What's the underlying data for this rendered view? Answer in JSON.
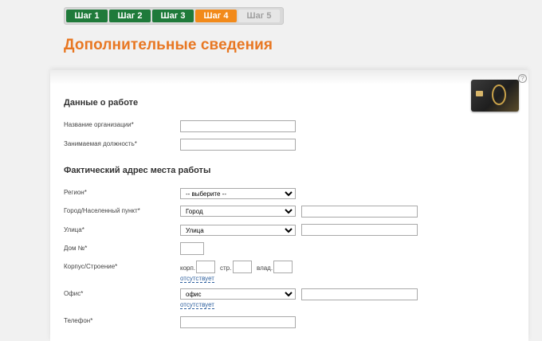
{
  "steps": [
    {
      "label": "Шаг 1",
      "state": "done"
    },
    {
      "label": "Шаг 2",
      "state": "done"
    },
    {
      "label": "Шаг 3",
      "state": "done"
    },
    {
      "label": "Шаг 4",
      "state": "active"
    },
    {
      "label": "Шаг 5",
      "state": "todo"
    }
  ],
  "page_title": "Дополнительные сведения",
  "help_icon": "?",
  "colors": {
    "step_done": "#1f7a3a",
    "step_active": "#f28a1a",
    "title": "#e87722",
    "link": "#2d5f9e"
  },
  "work": {
    "title": "Данные о работе",
    "org_label": "Название организации",
    "org_value": "",
    "position_label": "Занимаемая должность",
    "position_value": ""
  },
  "address": {
    "title": "Фактический адрес места работы",
    "region_label": "Регион",
    "region_value": "-- выберите --",
    "city_label": "Город/Населенный пункт",
    "city_type": "Город",
    "city_value": "",
    "street_label": "Улица",
    "street_type": "Улица",
    "street_value": "",
    "house_label": "Дом №",
    "house_value": "",
    "building_label": "Корпус/Строение",
    "korp_label": "корп.",
    "str_label": "стр.",
    "vlad_label": "влад.",
    "building_absent_link": "отсутствует",
    "office_label": "Офис",
    "office_type": "офис",
    "office_value": "",
    "office_absent_link": "отсутствует",
    "phone_label": "Телефон",
    "phone_value": ""
  },
  "required_mark": "*"
}
